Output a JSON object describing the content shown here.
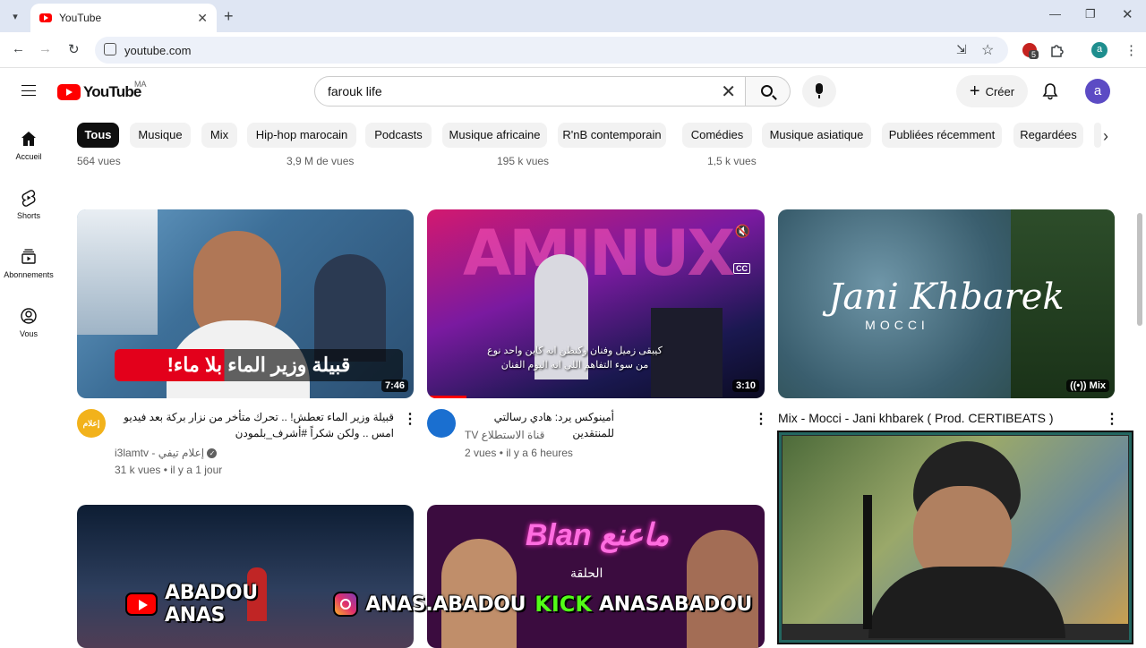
{
  "browser": {
    "tab_title": "YouTube",
    "url": "youtube.com",
    "extension_badge": "5",
    "profile_initial": "a"
  },
  "header": {
    "logo_text": "YouTube",
    "region": "MA",
    "search_value": "farouk life",
    "create_label": "Créer",
    "avatar_initial": "a"
  },
  "sidebar": {
    "items": [
      {
        "label": "Accueil",
        "icon": "home-icon"
      },
      {
        "label": "Shorts",
        "icon": "shorts-icon"
      },
      {
        "label": "Abonnements",
        "icon": "subscriptions-icon"
      },
      {
        "label": "Vous",
        "icon": "you-icon"
      }
    ]
  },
  "chips": [
    "Tous",
    "Musique",
    "Mix",
    "Hip-hop marocain",
    "Podcasts",
    "Musique africaine",
    "R'nB contemporain",
    "Comédies",
    "Musique asiatique",
    "Publiées récemment",
    "Regardées"
  ],
  "previous_row_views": [
    "564 vues",
    "3,9 M de vues",
    "195 k vues",
    "1,5 k vues"
  ],
  "videos": [
    {
      "title": "قبيلة وزير الماء تعطش! .. تحرك متأخر من نزار بركة بعد فيديو امس .. ولكن شكراً #أشرف_بلمودن",
      "thumb_text": "قبيلة وزير الماء بلا ماء!",
      "channel": "i3lamtv - إعلام تيفي",
      "meta": "31 k vues • il y a 1 jour",
      "duration": "7:46",
      "channel_avatar_text": "إعلام"
    },
    {
      "title": "أمينوكس يرد: هادي رسالتي للمنتقدين",
      "thumb_text_1": "كيبقى زميل وفنان وكنظن انه كاين واحد نوع",
      "thumb_text_2": "من سوء التفاهم اللي انه اليوم الفنان",
      "thumb_big": "AMINUX",
      "channel": "قناة الاستطلاع TV",
      "meta": "2 vues • il y a 6 heures",
      "duration": "3:10"
    },
    {
      "title": "Mix - Mocci - Jani khbarek ( Prod. CERTIBEATS )",
      "thumb_title": "Jani Khbarek",
      "thumb_sub": "MOCCI",
      "badge": "Mix"
    }
  ],
  "row2": {
    "thumb2_text": "Blan ماعنع",
    "thumb2_sub": "الحلقة"
  },
  "overlay": {
    "youtube_handle": "ABADOU ANAS",
    "instagram_handle": "ANAS.ABADOU",
    "kick_label": "KICK",
    "kick_handle": "ANASABADOU"
  },
  "colors": {
    "yt_red": "#ff0000",
    "kick_green": "#53fc18",
    "avatar": "#5c4bc4"
  }
}
